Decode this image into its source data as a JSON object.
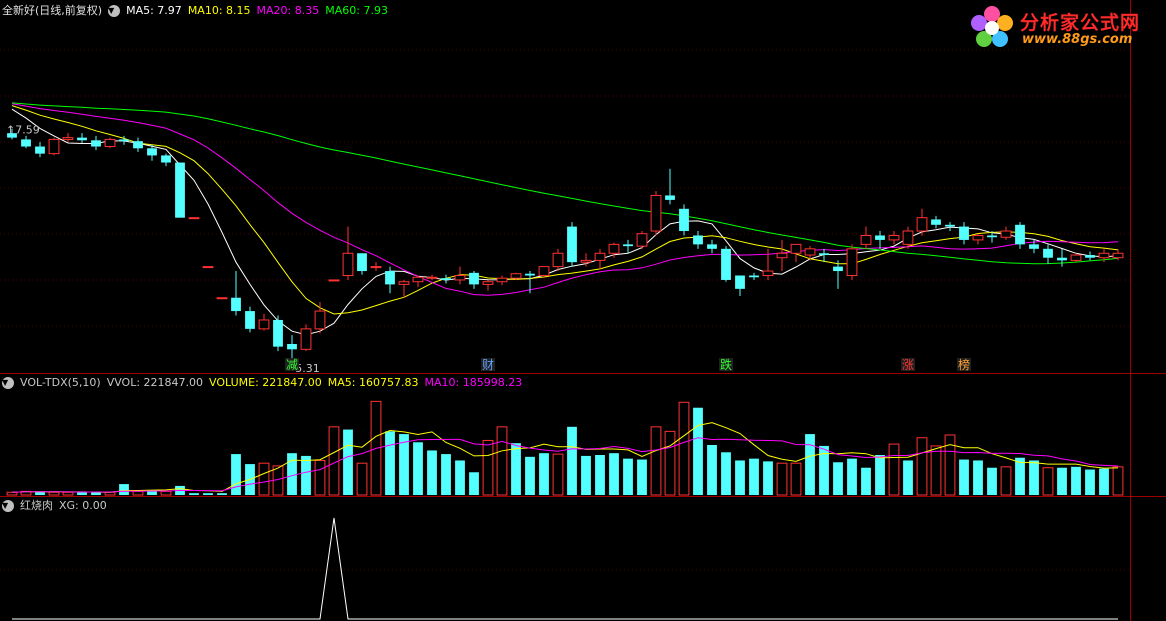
{
  "main_panel": {
    "stock_name": "全新好(日线,前复权)",
    "ma5_label": "MA5: 7.97",
    "ma10_label": "MA10: 8.15",
    "ma20_label": "MA20: 8.35",
    "ma60_label": "MA60: 7.93",
    "high_marker": "7.59",
    "low_marker": "5.31",
    "events": [
      {
        "text": "减",
        "color": "#30ff30"
      },
      {
        "text": "财",
        "color": "#60a0ff"
      },
      {
        "text": "跌",
        "color": "#30ff30"
      },
      {
        "text": "涨",
        "color": "#ff3030"
      },
      {
        "text": "榜",
        "color": "#ffa030"
      }
    ]
  },
  "volume_panel": {
    "indicator": "VOL-TDX(5,10)",
    "vvol_label": "VVOL: 221847.00",
    "volume_label": "VOLUME: 221847.00",
    "ma5_label": "MA5: 160757.83",
    "ma10_label": "MA10: 185998.23"
  },
  "xg_panel": {
    "indicator": "红烧肉",
    "xg_label": "XG: 0.00"
  },
  "logo": {
    "brand_name": "分析家公式网",
    "brand_url": "www.88gs.com"
  },
  "colors": {
    "up": "#ff3232",
    "down": "#54ffff",
    "ma5": "#ffffff",
    "ma10": "#ffff00",
    "ma20": "#ff00ff",
    "ma60": "#00ff00",
    "grid": "#a00000"
  },
  "chart_data": {
    "type": "candlestick",
    "price_ylim": [
      5.0,
      8.8
    ],
    "candles": [
      [
        7.55,
        7.6,
        7.5,
        7.48
      ],
      [
        7.48,
        7.52,
        7.4,
        7.38
      ],
      [
        7.4,
        7.45,
        7.32,
        7.28
      ],
      [
        7.32,
        7.5,
        7.48,
        7.3
      ],
      [
        7.48,
        7.55,
        7.5,
        7.45
      ],
      [
        7.5,
        7.55,
        7.47,
        7.44
      ],
      [
        7.47,
        7.52,
        7.4,
        7.36
      ],
      [
        7.4,
        7.5,
        7.48,
        7.38
      ],
      [
        7.48,
        7.52,
        7.46,
        7.42
      ],
      [
        7.46,
        7.5,
        7.38,
        7.34
      ],
      [
        7.38,
        7.42,
        7.3,
        7.24
      ],
      [
        7.3,
        7.32,
        7.22,
        7.18
      ],
      [
        7.22,
        7.22,
        6.6,
        6.6
      ],
      [
        6.6,
        6.6,
        6.6,
        6.6
      ],
      [
        6.05,
        6.05,
        6.05,
        6.05
      ],
      [
        5.7,
        5.7,
        5.7,
        5.7
      ],
      [
        5.7,
        6.0,
        5.55,
        5.5
      ],
      [
        5.55,
        5.6,
        5.35,
        5.31
      ],
      [
        5.35,
        5.52,
        5.45,
        5.33
      ],
      [
        5.45,
        5.5,
        5.15,
        5.1
      ],
      [
        5.18,
        5.28,
        5.12,
        5.02
      ],
      [
        5.12,
        5.4,
        5.35,
        5.1
      ],
      [
        5.35,
        5.65,
        5.55,
        5.3
      ],
      [
        5.9,
        5.9,
        5.9,
        5.9
      ],
      [
        5.95,
        6.5,
        6.2,
        5.9
      ],
      [
        6.2,
        6.2,
        6.0,
        5.96
      ],
      [
        6.05,
        6.1,
        6.05,
        6.0
      ],
      [
        6.0,
        6.05,
        5.85,
        5.75
      ],
      [
        5.85,
        5.9,
        5.88,
        5.7
      ],
      [
        5.88,
        5.95,
        5.93,
        5.82
      ],
      [
        5.93,
        5.96,
        5.93,
        5.9
      ],
      [
        5.92,
        5.96,
        5.9,
        5.86
      ],
      [
        5.9,
        6.05,
        5.95,
        5.85
      ],
      [
        5.98,
        6.0,
        5.85,
        5.8
      ],
      [
        5.85,
        5.9,
        5.88,
        5.78
      ],
      [
        5.88,
        5.95,
        5.92,
        5.84
      ],
      [
        5.92,
        5.98,
        5.97,
        5.9
      ],
      [
        5.97,
        6.0,
        5.95,
        5.75
      ],
      [
        5.95,
        6.05,
        6.05,
        5.92
      ],
      [
        6.05,
        6.25,
        6.2,
        6.0
      ],
      [
        6.5,
        6.55,
        6.1,
        6.05
      ],
      [
        6.1,
        6.2,
        6.12,
        6.05
      ],
      [
        6.12,
        6.25,
        6.2,
        6.02
      ],
      [
        6.2,
        6.32,
        6.3,
        6.15
      ],
      [
        6.3,
        6.35,
        6.28,
        6.2
      ],
      [
        6.28,
        6.45,
        6.42,
        6.25
      ],
      [
        6.45,
        6.9,
        6.85,
        6.4
      ],
      [
        6.85,
        7.15,
        6.8,
        6.75
      ],
      [
        6.7,
        6.75,
        6.45,
        6.4
      ],
      [
        6.4,
        6.45,
        6.3,
        6.25
      ],
      [
        6.3,
        6.35,
        6.25,
        6.2
      ],
      [
        6.25,
        6.28,
        5.9,
        5.88
      ],
      [
        5.95,
        5.95,
        5.8,
        5.72
      ],
      [
        5.95,
        5.98,
        5.93,
        5.9
      ],
      [
        5.95,
        6.25,
        6.0,
        5.9
      ],
      [
        6.15,
        6.35,
        6.2,
        6.0
      ],
      [
        6.2,
        6.25,
        6.3,
        6.1
      ],
      [
        6.18,
        6.28,
        6.25,
        6.12
      ],
      [
        6.2,
        6.25,
        6.18,
        6.1
      ],
      [
        6.05,
        6.12,
        6.0,
        5.8
      ],
      [
        5.95,
        6.3,
        6.25,
        5.9
      ],
      [
        6.3,
        6.5,
        6.4,
        6.25
      ],
      [
        6.4,
        6.45,
        6.35,
        6.25
      ],
      [
        6.35,
        6.45,
        6.4,
        6.3
      ],
      [
        6.3,
        6.5,
        6.45,
        6.25
      ],
      [
        6.45,
        6.7,
        6.6,
        6.4
      ],
      [
        6.58,
        6.62,
        6.52,
        6.48
      ],
      [
        6.52,
        6.55,
        6.5,
        6.45
      ],
      [
        6.5,
        6.55,
        6.35,
        6.3
      ],
      [
        6.35,
        6.42,
        6.4,
        6.3
      ],
      [
        6.4,
        6.45,
        6.38,
        6.32
      ],
      [
        6.38,
        6.5,
        6.45,
        6.35
      ],
      [
        6.52,
        6.55,
        6.3,
        6.25
      ],
      [
        6.3,
        6.35,
        6.25,
        6.2
      ],
      [
        6.25,
        6.3,
        6.15,
        6.08
      ],
      [
        6.15,
        6.25,
        6.12,
        6.05
      ],
      [
        6.12,
        6.2,
        6.18,
        6.1
      ],
      [
        6.18,
        6.22,
        6.15,
        6.12
      ],
      [
        6.15,
        6.25,
        6.2,
        6.1
      ],
      [
        6.15,
        6.25,
        6.2,
        6.12
      ]
    ],
    "volume": [
      [
        3,
        0
      ],
      [
        4,
        0
      ],
      [
        4,
        1
      ],
      [
        3,
        0
      ],
      [
        3,
        0
      ],
      [
        3,
        1
      ],
      [
        3,
        1
      ],
      [
        3,
        0
      ],
      [
        12,
        1
      ],
      [
        4,
        0
      ],
      [
        5,
        1
      ],
      [
        4,
        0
      ],
      [
        10,
        1
      ],
      [
        2,
        1
      ],
      [
        2,
        1
      ],
      [
        2,
        1
      ],
      [
        45,
        1
      ],
      [
        34,
        1
      ],
      [
        35,
        0
      ],
      [
        32,
        0
      ],
      [
        46,
        1
      ],
      [
        43,
        1
      ],
      [
        38,
        0
      ],
      [
        75,
        0
      ],
      [
        72,
        1
      ],
      [
        35,
        0
      ],
      [
        103,
        0
      ],
      [
        70,
        1
      ],
      [
        67,
        1
      ],
      [
        58,
        1
      ],
      [
        49,
        1
      ],
      [
        45,
        1
      ],
      [
        38,
        1
      ],
      [
        25,
        1
      ],
      [
        60,
        0
      ],
      [
        75,
        0
      ],
      [
        57,
        1
      ],
      [
        42,
        1
      ],
      [
        46,
        1
      ],
      [
        45,
        0
      ],
      [
        75,
        1
      ],
      [
        43,
        1
      ],
      [
        44,
        1
      ],
      [
        46,
        1
      ],
      [
        40,
        1
      ],
      [
        39,
        1
      ],
      [
        75,
        0
      ],
      [
        70,
        0
      ],
      [
        102,
        0
      ],
      [
        96,
        1
      ],
      [
        55,
        1
      ],
      [
        47,
        1
      ],
      [
        38,
        1
      ],
      [
        40,
        1
      ],
      [
        37,
        1
      ],
      [
        35,
        0
      ],
      [
        35,
        0
      ],
      [
        67,
        1
      ],
      [
        54,
        1
      ],
      [
        36,
        1
      ],
      [
        40,
        1
      ],
      [
        30,
        1
      ],
      [
        44,
        1
      ],
      [
        56,
        0
      ],
      [
        38,
        1
      ],
      [
        63,
        0
      ],
      [
        54,
        0
      ],
      [
        66,
        0
      ],
      [
        39,
        1
      ],
      [
        38,
        1
      ],
      [
        30,
        1
      ],
      [
        31,
        0
      ],
      [
        41,
        1
      ],
      [
        38,
        1
      ],
      [
        30,
        0
      ],
      [
        30,
        1
      ],
      [
        31,
        1
      ],
      [
        28,
        1
      ],
      [
        29,
        1
      ],
      [
        31,
        0
      ]
    ],
    "xg_signal": [
      0,
      0,
      0,
      0,
      0,
      0,
      0,
      0,
      0,
      0,
      0,
      0,
      0,
      0,
      0,
      0,
      0,
      0,
      0,
      0,
      0,
      0,
      0,
      1,
      0,
      0,
      0,
      0,
      0,
      0,
      0,
      0,
      0,
      0,
      0,
      0,
      0,
      0,
      0,
      0,
      0,
      0,
      0,
      0,
      0,
      0,
      0,
      0,
      0,
      0,
      0,
      0,
      0,
      0,
      0,
      0,
      0,
      0,
      0,
      0,
      0,
      0,
      0,
      0,
      0,
      0,
      0,
      0,
      0,
      0,
      0,
      0,
      0,
      0,
      0,
      0,
      0,
      0,
      0,
      0
    ]
  }
}
